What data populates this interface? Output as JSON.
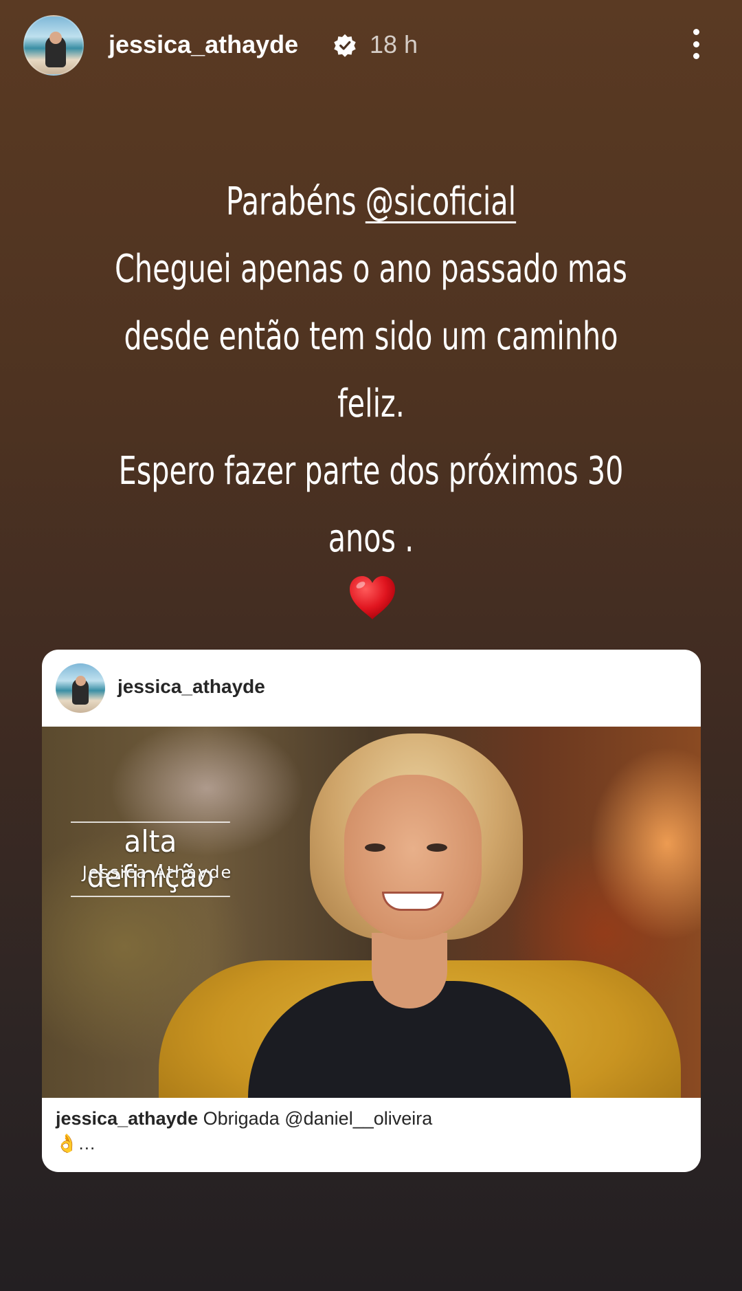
{
  "header": {
    "username": "jessica_athayde",
    "time": "18 h",
    "verified_icon": "verified-badge-icon",
    "more_icon": "more-options-icon"
  },
  "caption": {
    "line1_prefix": "Parabéns ",
    "line1_mention": "@sicoficial",
    "line2": "Cheguei apenas o ano passado mas",
    "line3": "desde então tem sido um caminho",
    "line4": "feliz.",
    "line5": "Espero fazer parte dos próximos 30",
    "line6": "anos .",
    "emoji": "heart-emoji"
  },
  "shared_post": {
    "username": "jessica_athayde",
    "overlay_title": "alta definição",
    "overlay_subtitle": "Jessica Athayde",
    "caption_user": "jessica_athayde",
    "caption_text": "Obrigada @daniel__oliveira",
    "caption_line2": "👌…"
  },
  "colors": {
    "bg_top": "#5a3a23",
    "bg_bottom": "#231f22",
    "verified_blue": "#ffffff"
  }
}
